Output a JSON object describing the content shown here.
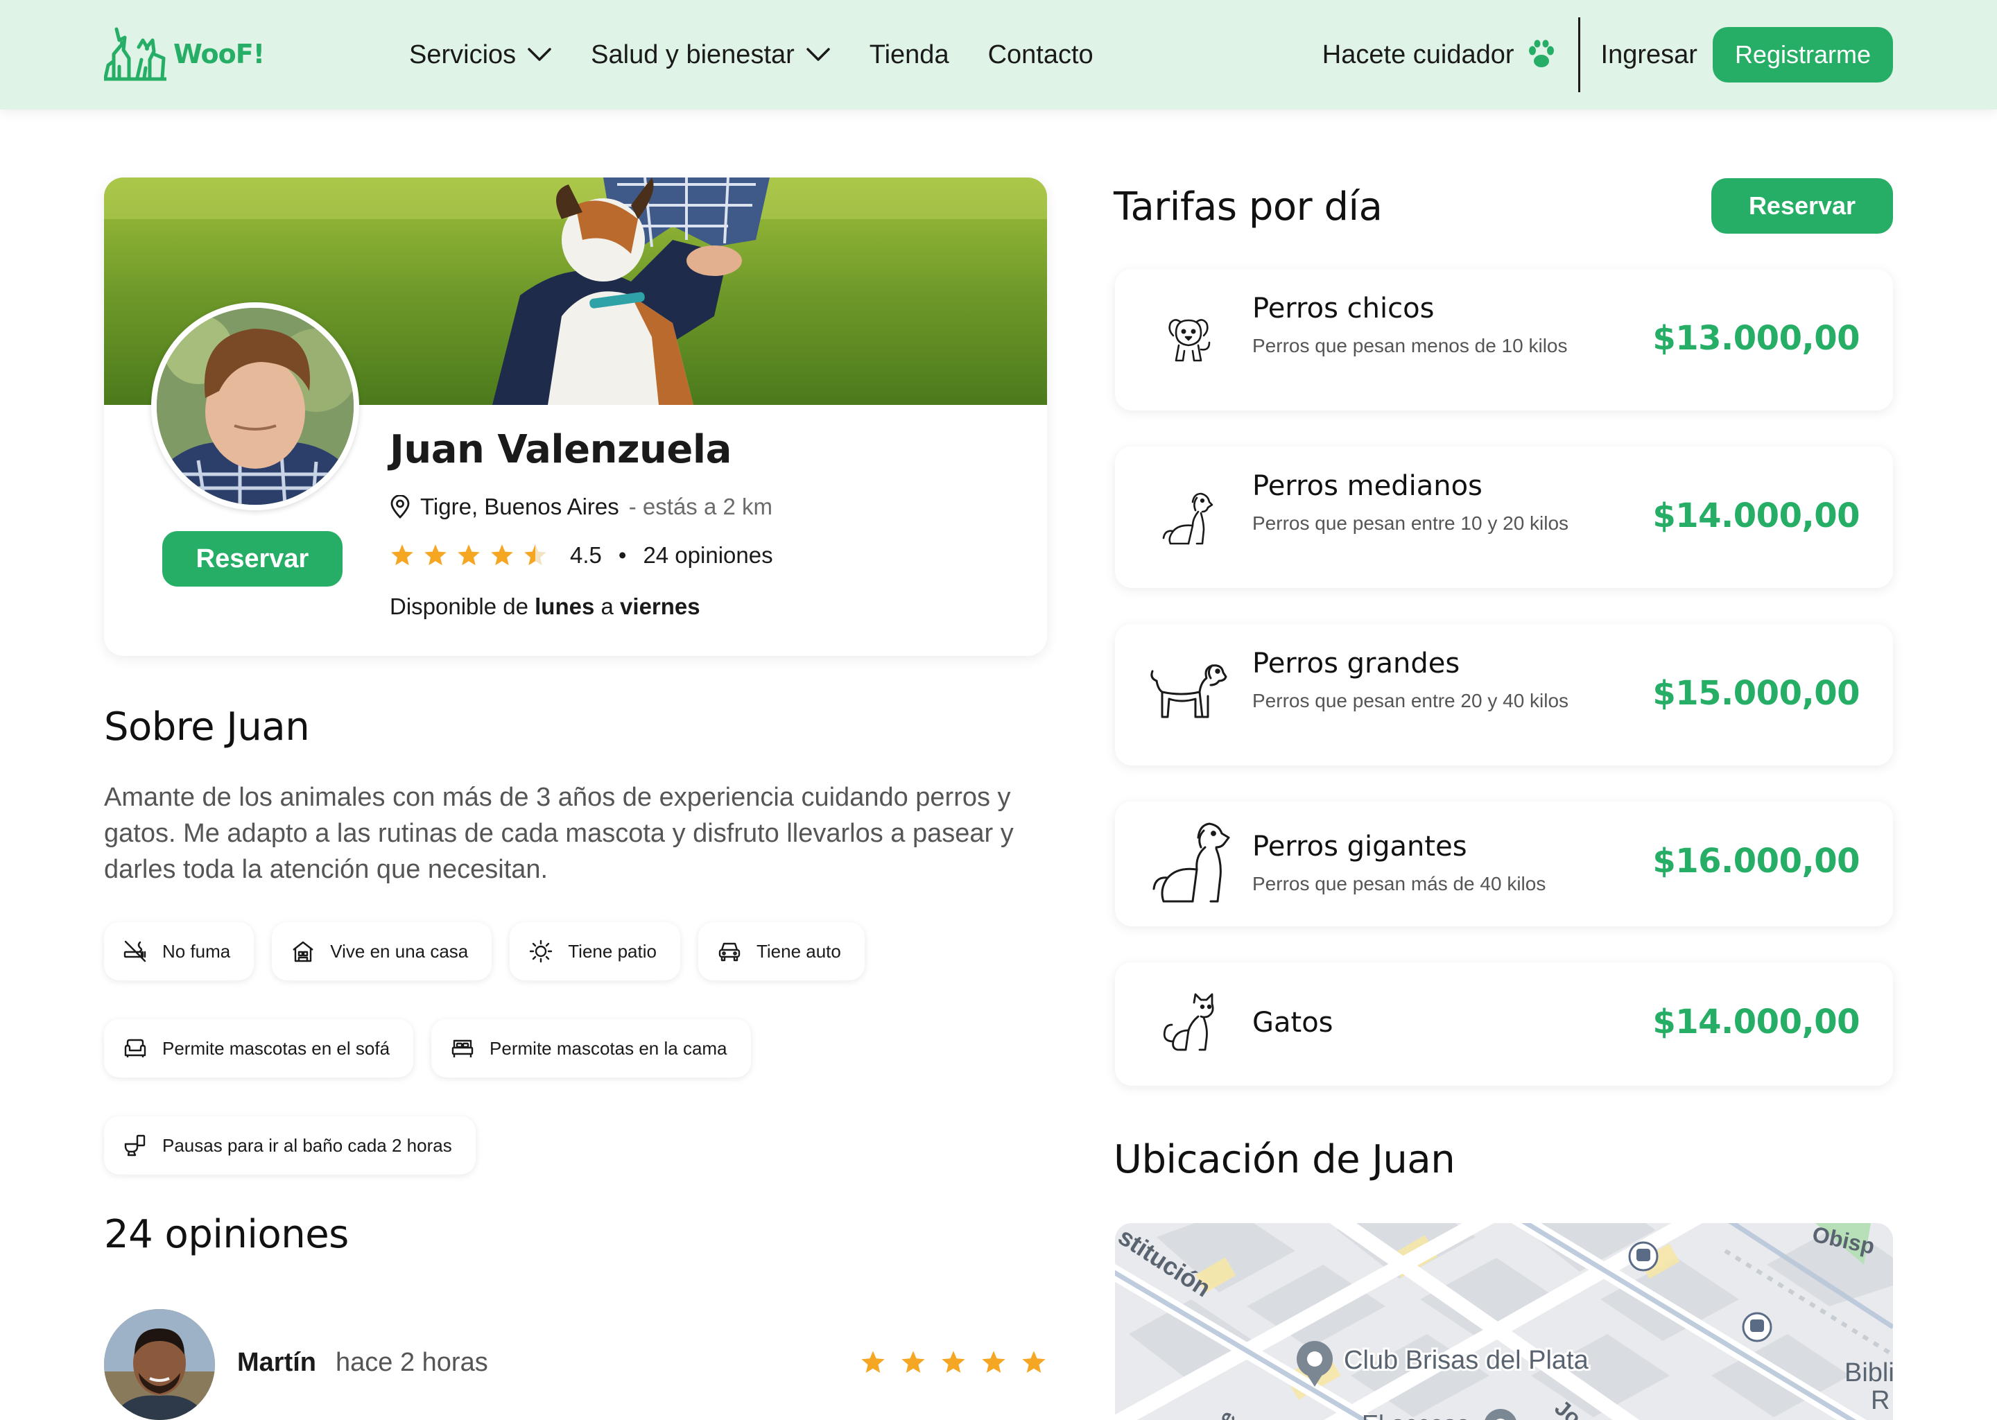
{
  "header": {
    "logo_text": "WooF!",
    "nav": [
      {
        "label": "Servicios",
        "dropdown": true
      },
      {
        "label": "Salud y bienestar",
        "dropdown": true
      },
      {
        "label": "Tienda",
        "dropdown": false
      },
      {
        "label": "Contacto",
        "dropdown": false
      }
    ],
    "caregiver_label": "Hacete cuidador",
    "login_label": "Ingresar",
    "register_label": "Registrarme"
  },
  "profile": {
    "name": "Juan Valenzuela",
    "location": "Tigre, Buenos Aires",
    "distance": "- estás a 2 km",
    "rating": 4.5,
    "rating_text": "4.5",
    "reviews_count_text": "24 opiniones",
    "availability_prefix": "Disponible de ",
    "availability_from": "lunes",
    "availability_mid": " a ",
    "availability_to": "viernes",
    "reserve_label": "Reservar"
  },
  "about": {
    "title": "Sobre Juan",
    "text": "Amante de los animales con más de 3 años de experiencia cuidando perros y gatos. Me adapto a las rutinas de cada mascota y disfruto llevarlos a pasear y darles toda la atención que necesitan.",
    "features": [
      {
        "label": "No fuma",
        "icon": "no-smoking-icon"
      },
      {
        "label": "Vive en una casa",
        "icon": "house-icon"
      },
      {
        "label": "Tiene patio",
        "icon": "sun-icon"
      },
      {
        "label": "Tiene auto",
        "icon": "car-icon"
      },
      {
        "label": "Permite mascotas en el sofá",
        "icon": "sofa-icon"
      },
      {
        "label": "Permite mascotas en la cama",
        "icon": "bed-icon"
      },
      {
        "label": "Pausas para ir al baño cada 2 horas",
        "icon": "toilet-icon"
      }
    ]
  },
  "reviews": {
    "title": "24 opiniones",
    "items": [
      {
        "name": "Martín",
        "time": "hace 2 horas",
        "stars": 5
      }
    ]
  },
  "rates": {
    "title": "Tarifas por día",
    "reserve_label": "Reservar",
    "items": [
      {
        "name": "Perros chicos",
        "desc": "Perros que pesan menos de 10 kilos",
        "price": "$13.000,00",
        "icon": "small-dog-icon"
      },
      {
        "name": "Perros medianos",
        "desc": "Perros que pesan entre 10 y 20 kilos",
        "price": "$14.000,00",
        "icon": "medium-dog-icon"
      },
      {
        "name": "Perros grandes",
        "desc": "Perros que pesan entre 20 y 40 kilos",
        "price": "$15.000,00",
        "icon": "large-dog-icon"
      },
      {
        "name": "Perros gigantes",
        "desc": "Perros que pesan más de 40 kilos",
        "price": "$16.000,00",
        "icon": "giant-dog-icon"
      },
      {
        "name": "Gatos",
        "desc": "",
        "price": "$14.000,00",
        "icon": "cat-icon"
      }
    ]
  },
  "map": {
    "title": "Ubicación de Juan",
    "labels": {
      "club": "Club Brisas del Plata",
      "street_left": "stitución",
      "top_right": "Obisp",
      "right": "Bibli",
      "right2": "R",
      "bottom": "El acceso",
      "bottom_left": "e",
      "bottom_mid": "Jo"
    }
  },
  "colors": {
    "brand_green": "#27ae66",
    "header_bg": "#dff3e7",
    "star": "#f5a623"
  }
}
